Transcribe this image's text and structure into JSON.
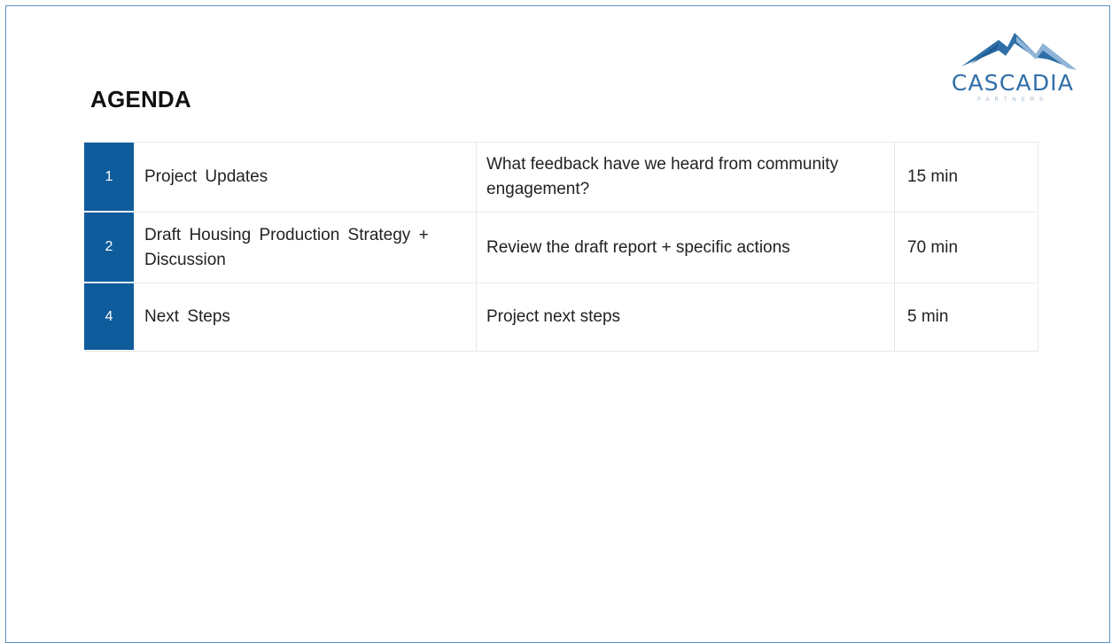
{
  "slide": {
    "title": "AGENDA"
  },
  "logo": {
    "name": "CASCADIA",
    "subtitle": "PARTNERS",
    "icon": "mountain-icon",
    "colors": {
      "primary": "#2f6ea7",
      "secondary": "#8fb4d8"
    }
  },
  "agenda": {
    "accent_color": "#0f5c9c",
    "rows": [
      {
        "number": "1",
        "item": "Project Updates",
        "description": "What feedback have we heard from community engagement?",
        "duration": "15 min"
      },
      {
        "number": "2",
        "item": "Draft Housing Production Strategy + Discussion",
        "description": "Review the draft report + specific actions",
        "duration": "70 min"
      },
      {
        "number": "4",
        "item": "Next Steps",
        "description": "Project next steps",
        "duration": "5 min"
      }
    ]
  }
}
